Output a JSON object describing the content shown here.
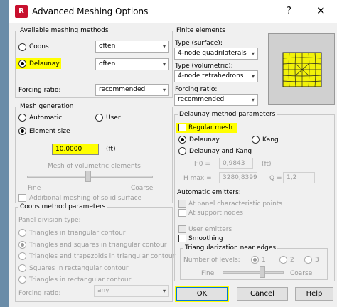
{
  "window": {
    "app_icon": "R",
    "title": "Advanced Meshing Options",
    "help_glyph": "?",
    "close_glyph": "✕"
  },
  "available": {
    "legend": "Available meshing methods",
    "coons_label": "Coons",
    "coons_value": "often",
    "delaunay_label": "Delaunay",
    "delaunay_value": "often",
    "forcing_label": "Forcing ratio:",
    "forcing_value": "recommended"
  },
  "mesh_generation": {
    "legend": "Mesh generation",
    "automatic_label": "Automatic",
    "user_label": "User",
    "element_size_label": "Element size",
    "element_size_value": "10,0000",
    "element_size_unit": "(ft)",
    "volumetric_label": "Mesh of volumetric elements",
    "fine_label": "Fine",
    "coarse_label": "Coarse",
    "additional_label": "Additional meshing of solid surface"
  },
  "coons": {
    "legend": "Coons method parameters",
    "panel_division_label": "Panel division type:",
    "options": [
      "Triangles in triangular contour",
      "Triangles and squares in triangular contour",
      "Triangles and trapezoids in triangular contour",
      "Squares in rectangular contour",
      "Triangles in rectangular contour"
    ],
    "forcing_label": "Forcing ratio:",
    "forcing_value": "any"
  },
  "finite": {
    "legend": "Finite elements",
    "surface_label": "Type (surface):",
    "surface_value": "4-node quadrilaterals",
    "volumetric_label": "Type (volumetric):",
    "volumetric_value": "4-node tetrahedrons",
    "forcing_label": "Forcing ratio:",
    "forcing_value": "recommended"
  },
  "delaunay_params": {
    "legend": "Delaunay method parameters",
    "regular_mesh_label": "Regular mesh",
    "delaunay_label": "Delaunay",
    "kang_label": "Kang",
    "delaunay_kang_label": "Delaunay and Kang",
    "h0_label": "H0 =",
    "h0_value": "0,9843",
    "h0_unit": "(ft)",
    "hmax_label": "H max =",
    "hmax_value": "3280,8399",
    "q_label": "Q =",
    "q_value": "1,2",
    "emitters_label": "Automatic emitters:",
    "panel_points_label": "At panel characteristic points",
    "support_nodes_label": "At support nodes",
    "user_emitters_label": "User emitters",
    "smoothing_label": "Smoothing",
    "triangularization_legend": "Triangularization near edges",
    "levels_label": "Number of levels:",
    "level_1": "1",
    "level_2": "2",
    "level_3": "3",
    "fine_label": "Fine",
    "coarse_label": "Coarse"
  },
  "buttons": {
    "ok": "OK",
    "cancel": "Cancel",
    "help": "Help"
  },
  "arrow_glyph": "▾",
  "colors": {
    "highlight": "#ffff00",
    "preview_fill": "#f2f20a",
    "window_bg": "#f0f0f0"
  }
}
